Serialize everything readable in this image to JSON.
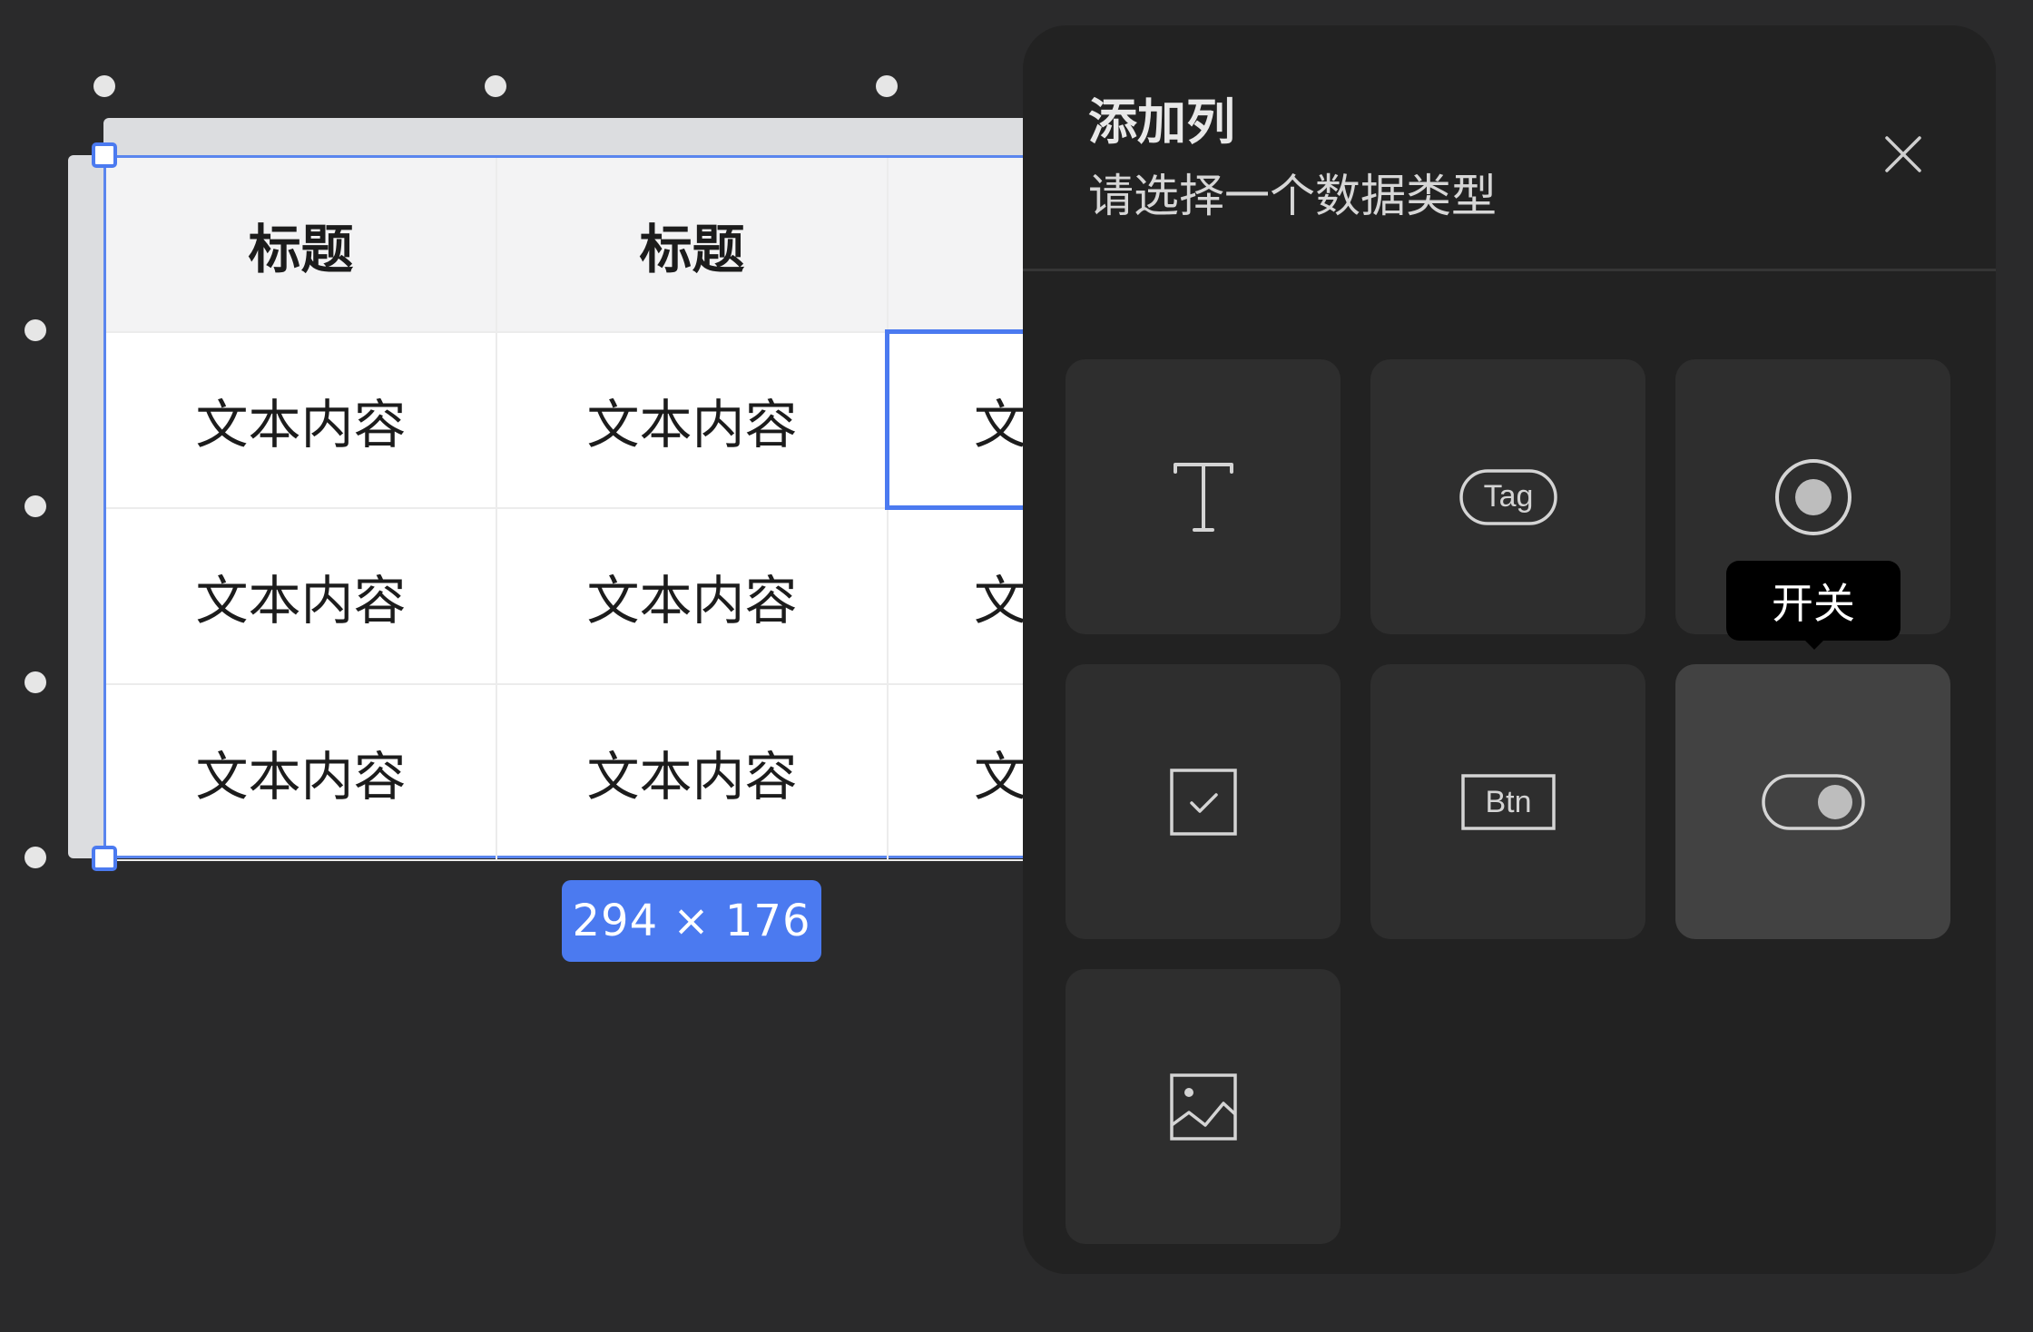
{
  "table": {
    "headers": [
      "标题",
      "标题",
      ""
    ],
    "rows": [
      [
        "文本内容",
        "文本内容",
        "文本内容"
      ],
      [
        "文本内容",
        "文本内容",
        "文本内容"
      ],
      [
        "文本内容",
        "文本内容",
        "文本内容"
      ]
    ],
    "size_label": "294 × 176"
  },
  "panel": {
    "title": "添加列",
    "subtitle": "请选择一个数据类型",
    "tooltip": "开关",
    "types": [
      {
        "icon": "text-type-icon"
      },
      {
        "icon": "tag-icon",
        "label": "Tag"
      },
      {
        "icon": "radio-icon"
      },
      {
        "icon": "checkbox-icon"
      },
      {
        "icon": "button-icon",
        "label": "Btn"
      },
      {
        "icon": "toggle-switch-icon"
      },
      {
        "icon": "image-icon"
      }
    ]
  },
  "colors": {
    "canvas": "#2a2a2b",
    "panel": "#222222",
    "tile": "#2e2e2e",
    "tile_hover": "#424242",
    "selection": "#4b7af0"
  }
}
